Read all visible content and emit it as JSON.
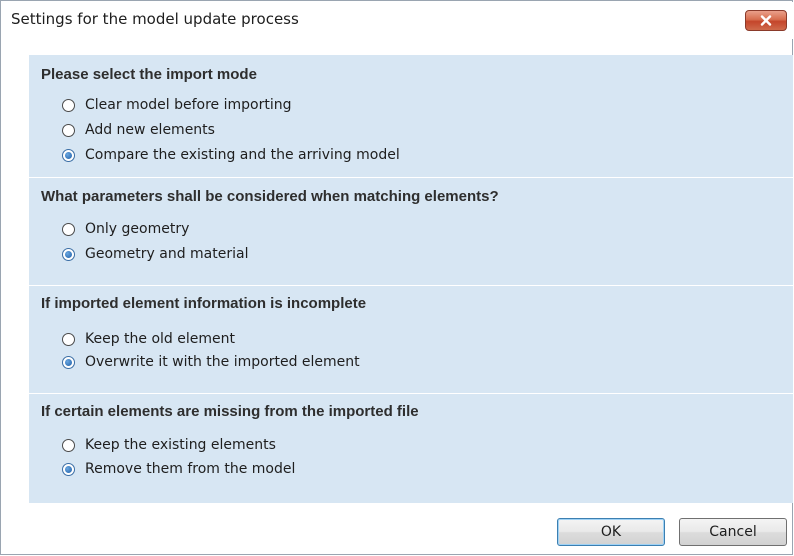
{
  "window": {
    "title": "Settings for the model update process"
  },
  "groups": [
    {
      "title": "Please select the import mode",
      "options": [
        {
          "label": "Clear model before importing",
          "checked": false
        },
        {
          "label": "Add new elements",
          "checked": false
        },
        {
          "label": "Compare the existing and the arriving model",
          "checked": true
        }
      ]
    },
    {
      "title": "What parameters shall be considered when matching elements?",
      "options": [
        {
          "label": "Only geometry",
          "checked": false
        },
        {
          "label": "Geometry and material",
          "checked": true
        }
      ]
    },
    {
      "title": "If imported element information is incomplete",
      "options": [
        {
          "label": "Keep the old element",
          "checked": false
        },
        {
          "label": "Overwrite it with the imported element",
          "checked": true
        }
      ]
    },
    {
      "title": "If certain elements are missing from the imported file",
      "options": [
        {
          "label": "Keep the existing elements",
          "checked": false
        },
        {
          "label": "Remove them from the model",
          "checked": true
        }
      ]
    }
  ],
  "buttons": {
    "ok_label": "OK",
    "cancel_label": "Cancel"
  },
  "colors": {
    "panel_background": "#d7e6f3",
    "close_button": "#c4452b",
    "radio_accent": "#1f5fa8"
  }
}
